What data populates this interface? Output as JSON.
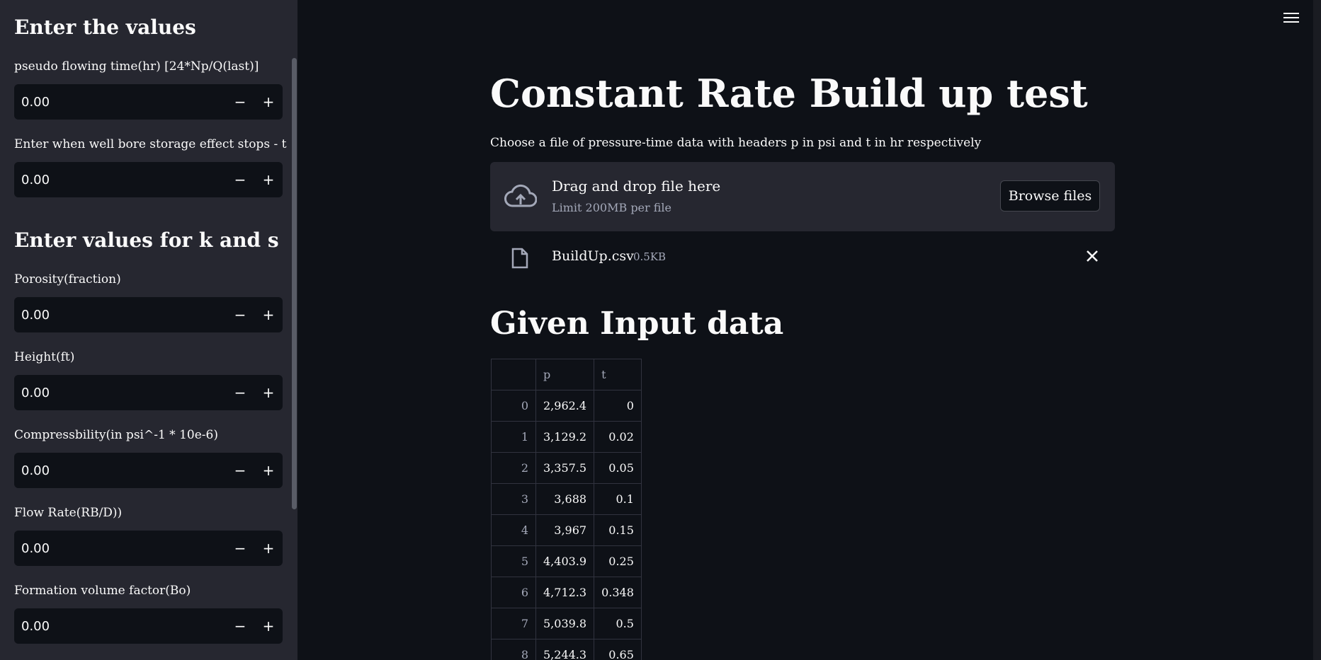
{
  "sidebar": {
    "heading1": "Enter the values",
    "heading2": "Enter values for k and s",
    "fields": [
      {
        "label": "pseudo flowing time(hr) [24*Np/Q(last)]",
        "value": "0.00"
      },
      {
        "label": "Enter when well bore storage effect stops - t",
        "value": "0.00"
      },
      {
        "label": "Porosity(fraction)",
        "value": "0.00"
      },
      {
        "label": "Height(ft)",
        "value": "0.00"
      },
      {
        "label": "Compressbility(in psi^-1 * 10e-6)",
        "value": "0.00"
      },
      {
        "label": "Flow Rate(RB/D))",
        "value": "0.00"
      },
      {
        "label": "Formation volume factor(Bo)",
        "value": "0.00"
      }
    ],
    "minus_label": "−",
    "plus_label": "+"
  },
  "main": {
    "title": "Constant Rate Build up test",
    "description": "Choose a file of pressure-time data with headers p in psi and t in hr respectively",
    "uploader": {
      "drop_title": "Drag and drop file here",
      "limit": "Limit 200MB per file",
      "browse_label": "Browse files"
    },
    "file": {
      "name": "BuildUp.csv",
      "size": "0.5KB"
    },
    "section_title": "Given Input data",
    "table": {
      "columns": [
        "",
        "p",
        "t"
      ],
      "rows": [
        [
          "0",
          "2,962.4",
          "0"
        ],
        [
          "1",
          "3,129.2",
          "0.02"
        ],
        [
          "2",
          "3,357.5",
          "0.05"
        ],
        [
          "3",
          "3,688",
          "0.1"
        ],
        [
          "4",
          "3,967",
          "0.15"
        ],
        [
          "5",
          "4,403.9",
          "0.25"
        ],
        [
          "6",
          "4,712.3",
          "0.348"
        ],
        [
          "7",
          "5,039.8",
          "0.5"
        ],
        [
          "8",
          "5,244.3",
          "0.65"
        ]
      ]
    }
  },
  "colors": {
    "background": "#0e1117",
    "sidebar": "#262730",
    "text": "#fafafa",
    "muted": "#a3a8b8"
  },
  "icons": [
    "menu-icon",
    "cloud-upload-icon",
    "file-icon",
    "close-icon"
  ]
}
